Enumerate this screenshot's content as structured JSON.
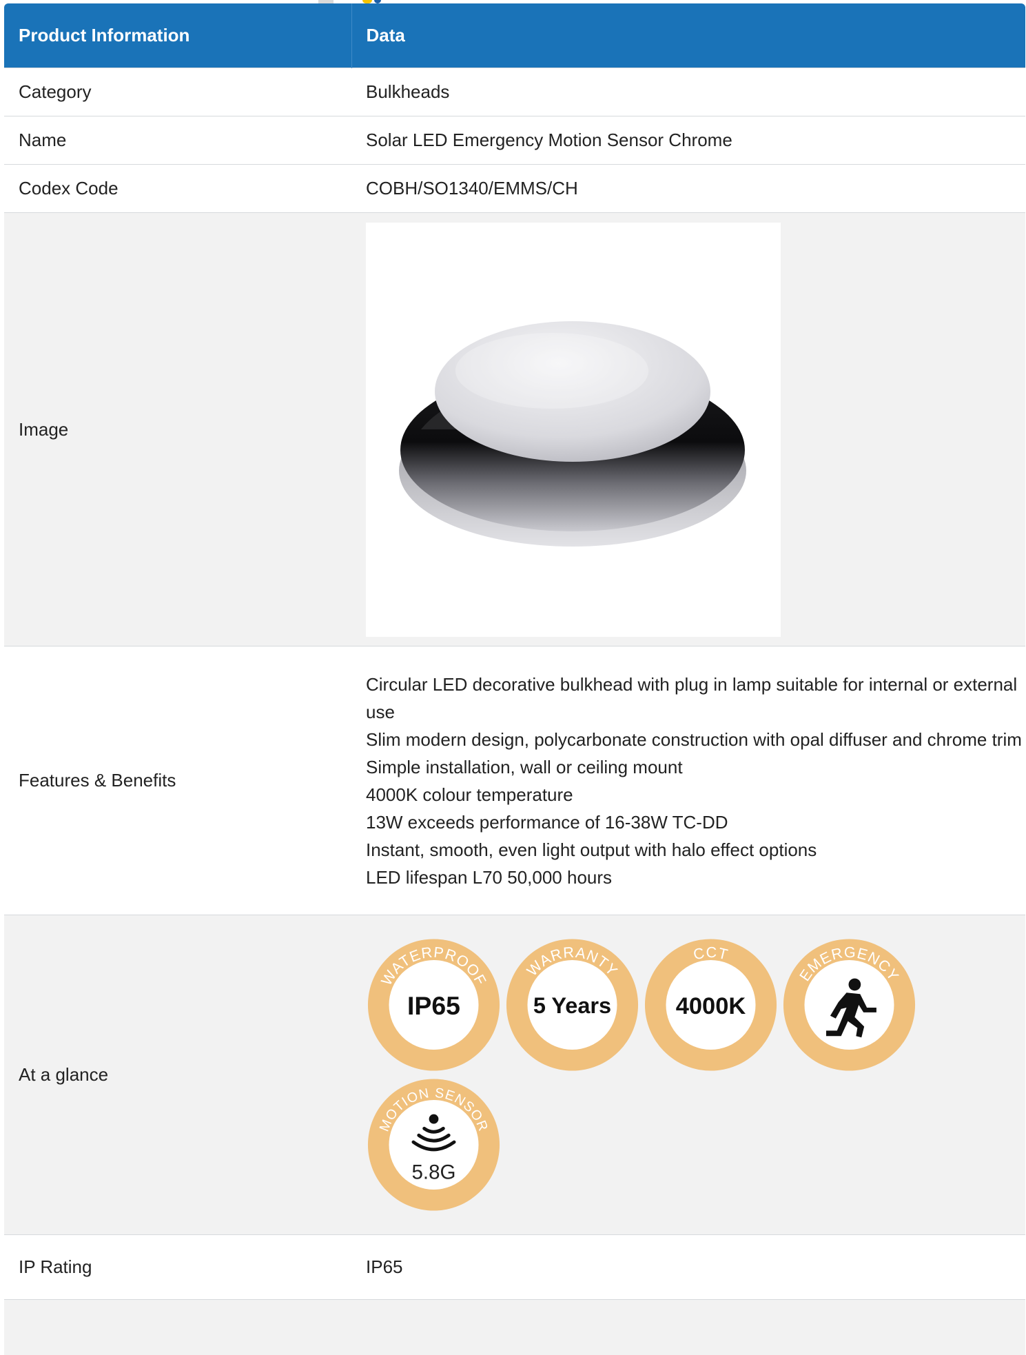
{
  "table": {
    "headers": [
      "Product Information",
      "Data"
    ],
    "rows": {
      "category": {
        "label": "Category",
        "value": "Bulkheads"
      },
      "name": {
        "label": "Name",
        "value": "Solar LED Emergency Motion Sensor Chrome"
      },
      "code": {
        "label": "Codex Code",
        "value": "COBH/SO1340/EMMS/CH"
      },
      "image": {
        "label": "Image"
      },
      "features": {
        "label": "Features & Benefits",
        "items": [
          "Circular LED decorative bulkhead with plug in lamp suitable for internal or external use",
          "Slim modern design, polycarbonate construction with opal diffuser and chrome trim",
          "Simple installation, wall or ceiling mount",
          "4000K colour temperature",
          "13W exceeds performance of 16-38W TC-DD",
          "Instant, smooth, even light output with halo effect options",
          "LED lifespan L70 50,000 hours"
        ]
      },
      "glance": {
        "label": "At a glance",
        "badges": [
          {
            "arc": "WATERPROOF",
            "center": "IP65",
            "icon": "none"
          },
          {
            "arc": "WARRANTY",
            "center": "5 Years",
            "icon": "none"
          },
          {
            "arc": "CCT",
            "center": "4000K",
            "icon": "none"
          },
          {
            "arc": "EMERGENCY",
            "center": "",
            "icon": "running-man-icon"
          },
          {
            "arc": "MOTION SENSOR",
            "center": "5.8G",
            "icon": "motion-waves-icon"
          }
        ]
      },
      "ip": {
        "label": "IP Rating",
        "value": "IP65"
      }
    }
  },
  "colors": {
    "header_bg": "#1a73b8",
    "badge_ring": "#f0c07c",
    "badge_face": "#ffffff"
  }
}
